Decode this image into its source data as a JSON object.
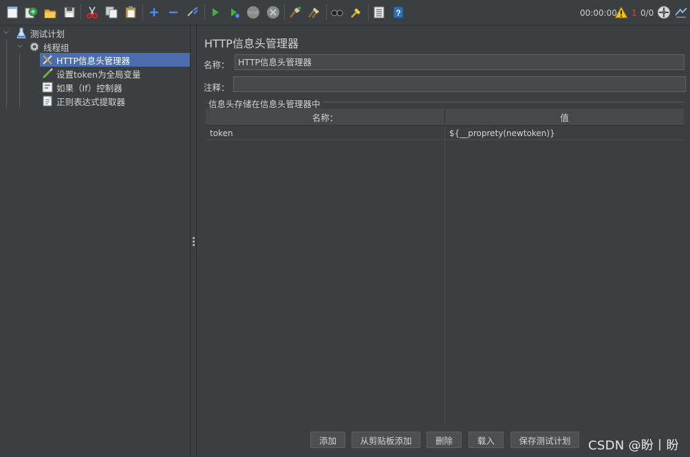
{
  "toolbar": {
    "icons": [
      "new-icon",
      "templates-icon",
      "open-icon",
      "save-icon",
      "cut-icon",
      "copy-icon",
      "paste-icon",
      "expand-icon",
      "collapse-icon",
      "toggle-icon",
      "start-icon",
      "start-no-pause-icon",
      "stop-icon",
      "shutdown-icon",
      "clear-icon",
      "clear-all-icon",
      "search-icon",
      "reset-search-icon",
      "function-helper-icon",
      "help-icon",
      "warning-icon",
      "remote-icon",
      "log-icon"
    ],
    "timer": "00:00:00",
    "error_count": "1",
    "thread_count": "0/0"
  },
  "tree": {
    "items": [
      {
        "label": "测试计划",
        "icon": "test-plan-flask-icon"
      },
      {
        "label": "线程组",
        "icon": "thread-group-gear-icon"
      },
      {
        "label": "HTTP信息头管理器",
        "icon": "header-manager-tools-icon"
      },
      {
        "label": "设置token为全局变量",
        "icon": "beanshell-pen-icon"
      },
      {
        "label": "如果（If）控制器",
        "icon": "if-controller-icon"
      },
      {
        "label": "正则表达式提取器",
        "icon": "regex-extractor-icon"
      }
    ]
  },
  "panel": {
    "title": "HTTP信息头管理器",
    "name_label": "名称：",
    "name_value": "HTTP信息头管理器",
    "comment_label": "注释：",
    "comment_value": "",
    "group_title": "信息头存储在信息头管理器中",
    "table": {
      "headers": [
        "名称：",
        "值"
      ],
      "rows": [
        [
          "token",
          "${__proprety(newtoken)}"
        ]
      ]
    },
    "buttons": {
      "add": "添加",
      "add_clipboard": "从剪贴板添加",
      "delete": "删除",
      "load": "载入",
      "save_plan": "保存测试计划"
    }
  },
  "watermark": "CSDN @盼丨盼",
  "colors": {
    "background": "#3c3f41",
    "selected": "#4b6eaf",
    "error": "#e04040"
  }
}
